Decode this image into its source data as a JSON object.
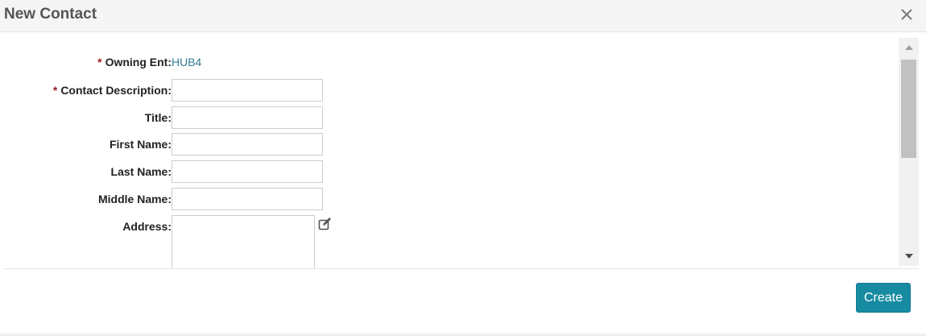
{
  "dialog": {
    "title": "New Contact",
    "close_icon": "close-icon"
  },
  "form": {
    "owning_ent": {
      "required_mark": "*",
      "label": "Owning Ent:",
      "value": "HUB4"
    },
    "contact_description": {
      "required_mark": "*",
      "label": "Contact Description:",
      "value": ""
    },
    "title": {
      "label": "Title:",
      "value": ""
    },
    "first_name": {
      "label": "First Name:",
      "value": ""
    },
    "last_name": {
      "label": "Last Name:",
      "value": ""
    },
    "middle_name": {
      "label": "Middle Name:",
      "value": ""
    },
    "address": {
      "label": "Address:",
      "value": "",
      "edit_icon": "edit-icon"
    }
  },
  "footer": {
    "create_label": "Create"
  },
  "colors": {
    "accent": "#178ba2",
    "required": "#9b1b1b",
    "link": "#337c93"
  }
}
